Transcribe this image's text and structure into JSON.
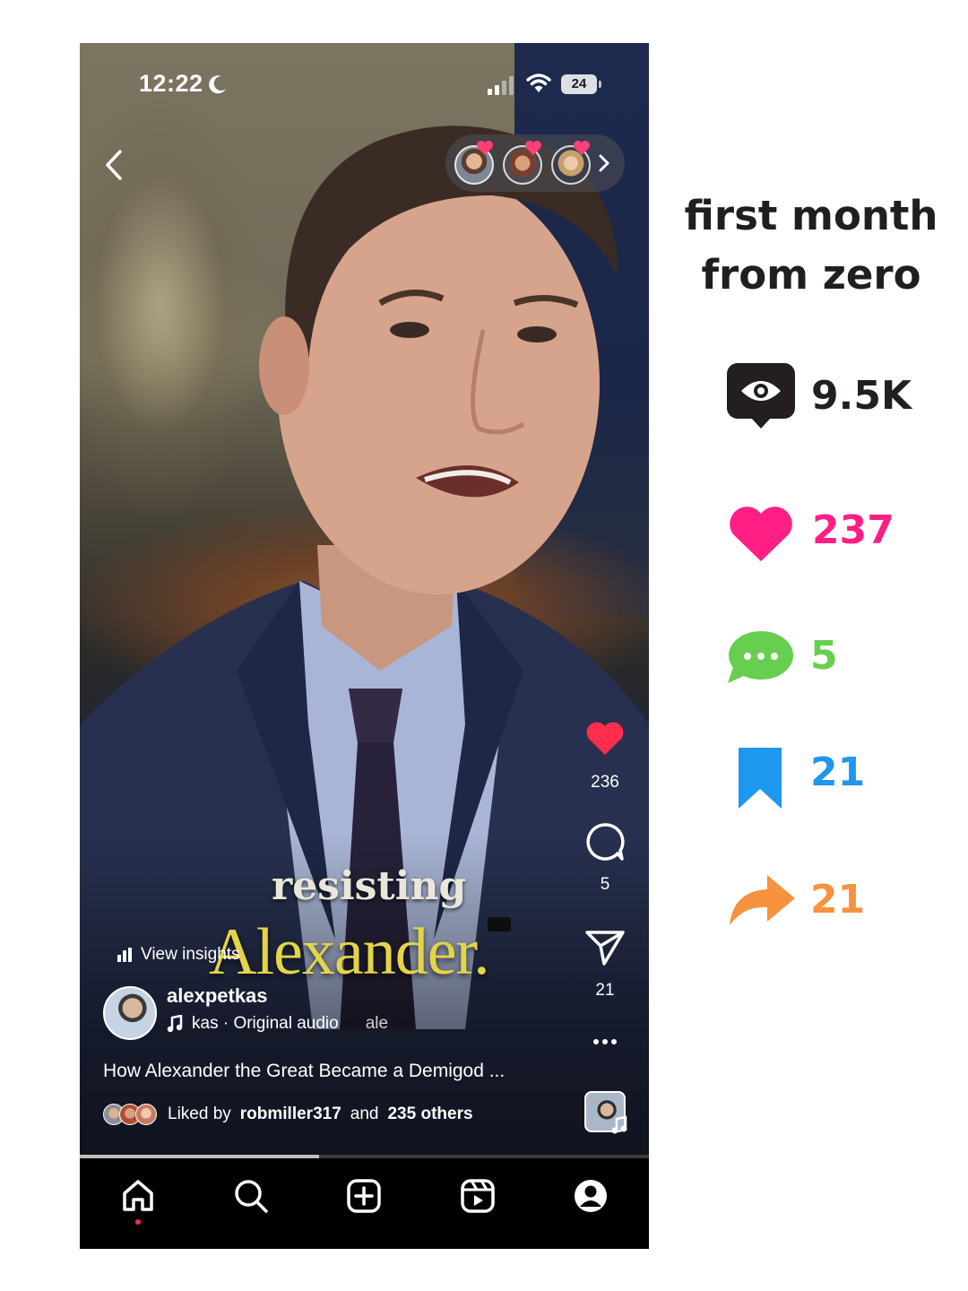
{
  "status_bar": {
    "time": "12:22",
    "battery": "24"
  },
  "friends": {
    "count": 3
  },
  "video_caption": {
    "line1": "resisting",
    "line2": "Alexander."
  },
  "rail": {
    "likes": "236",
    "comments": "5",
    "shares": "21"
  },
  "post": {
    "insights_label": "View insights",
    "username": "alexpetkas",
    "audio_text": "kas · Original audio",
    "audio_trail": "ale",
    "caption": "How Alexander the Great Became a Demigod ...",
    "liked_prefix": "Liked by",
    "liked_user": "robmiller317",
    "liked_middle": "and",
    "liked_others": "235 others"
  },
  "progress": {
    "fraction": 0.42
  },
  "stats_panel": {
    "headline_line1": "first month",
    "headline_line2": "from zero",
    "views": "9.5K",
    "likes": "237",
    "comments": "5",
    "saves": "21",
    "shares": "21"
  },
  "colors": {
    "likes": "#ff1f84",
    "comments": "#67cf4f",
    "saves": "#1e97ef",
    "shares": "#f7923f",
    "views_icon": "#231f1e",
    "caption_yellow": "#e3d547",
    "heart_red": "#ff2e4f"
  },
  "icons": {
    "nav": [
      "home-icon",
      "search-icon",
      "create-icon",
      "reels-icon",
      "profile-icon"
    ],
    "stats": [
      "eye-icon",
      "heart-icon",
      "speech-bubble-icon",
      "bookmark-icon",
      "share-arrow-icon"
    ]
  }
}
